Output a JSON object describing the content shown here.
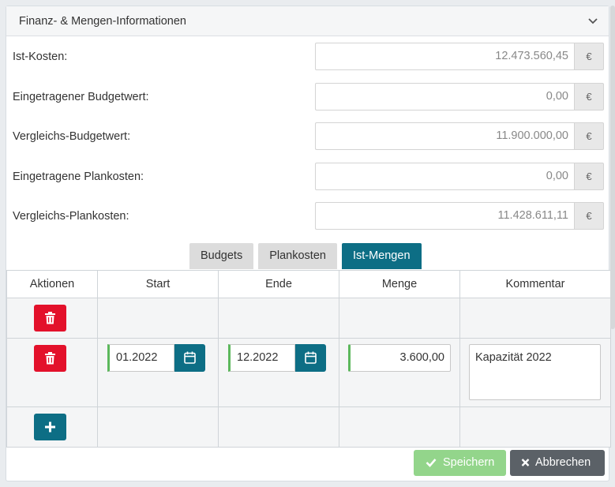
{
  "panel": {
    "title": "Finanz- & Mengen-Informationen",
    "currency_symbol": "€"
  },
  "fields": [
    {
      "label": "Ist-Kosten:",
      "value": "12.473.560,45"
    },
    {
      "label": "Eingetragener Budgetwert:",
      "value": "0,00"
    },
    {
      "label": "Vergleichs-Budgetwert:",
      "value": "11.900.000,00"
    },
    {
      "label": "Eingetragene Plankosten:",
      "value": "0,00"
    },
    {
      "label": "Vergleichs-Plankosten:",
      "value": "11.428.611,11"
    }
  ],
  "tabs": [
    {
      "label": "Budgets",
      "active": false
    },
    {
      "label": "Plankosten",
      "active": false
    },
    {
      "label": "Ist-Mengen",
      "active": true
    }
  ],
  "table": {
    "headers": [
      "Aktionen",
      "Start",
      "Ende",
      "Menge",
      "Kommentar"
    ],
    "row": {
      "start": "01.2022",
      "end": "12.2022",
      "quantity": "3.600,00",
      "comment": "Kapazität 2022"
    }
  },
  "footer": {
    "save_label": "Speichern",
    "cancel_label": "Abbrechen"
  },
  "colors": {
    "primary": "#0d6e85",
    "danger": "#e3112b",
    "success_disabled": "#93d58b",
    "secondary": "#5b6167",
    "valid_border": "#5cb85c"
  }
}
